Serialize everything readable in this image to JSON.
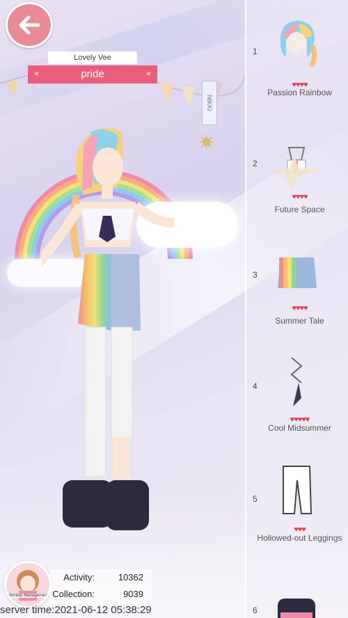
{
  "header": {
    "back_icon": "back-arrow-icon"
  },
  "nameplate": {
    "subtitle": "Lovely Vee",
    "title": "pride"
  },
  "banner": {
    "sign_text": "NIKKI"
  },
  "items": [
    {
      "index": "1",
      "name": "Passion Rainbow",
      "hearts": "♥♥♥♥",
      "icon": "hair-icon"
    },
    {
      "index": "2",
      "name": "Future Space",
      "hearts": "♥♥♥♥",
      "icon": "top-icon"
    },
    {
      "index": "3",
      "name": "Summer Tale",
      "hearts": "♥♥♥♥",
      "icon": "skirt-icon"
    },
    {
      "index": "4",
      "name": "Cool Midsummer",
      "hearts": "♥♥♥♥♥",
      "icon": "necklace-icon"
    },
    {
      "index": "5",
      "name": "Hollowed-out Leggings",
      "hearts": "♥♥♥",
      "icon": "leggings-icon"
    },
    {
      "index": "6",
      "name": "",
      "hearts": "",
      "icon": "shoes-icon"
    }
  ],
  "profile": {
    "label": "Member Management"
  },
  "stats": {
    "activity_label": "Activity:",
    "activity_value": "10362",
    "collection_label": "Collection:",
    "collection_value": "9039"
  },
  "server_time": "server time:2021-06-12 05:38:29",
  "colors": {
    "accent": "#ea5d7b",
    "heart": "#e23d48",
    "back_button": "#e98a97"
  }
}
